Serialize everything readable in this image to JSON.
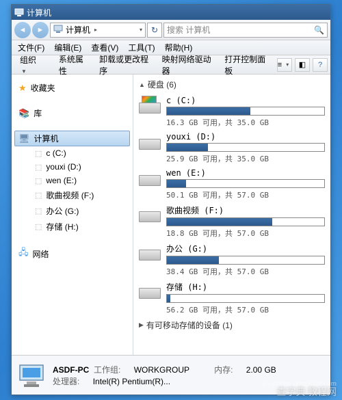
{
  "window": {
    "title": "计算机"
  },
  "addressbar": {
    "breadcrumb": "计算机",
    "search_placeholder": "搜索 计算机"
  },
  "menubar": {
    "file": "文件(F)",
    "edit": "编辑(E)",
    "view": "查看(V)",
    "tools": "工具(T)",
    "help": "帮助(H)"
  },
  "toolbar": {
    "organize": "组织",
    "sysprops": "系统属性",
    "uninstall": "卸载或更改程序",
    "mapdrive": "映射网络驱动器",
    "controlpanel": "打开控制面板"
  },
  "sidebar": {
    "favorites": "收藏夹",
    "libraries": "库",
    "computer": "计算机",
    "network": "网络",
    "drives": [
      {
        "label": "c (C:)"
      },
      {
        "label": "youxi (D:)"
      },
      {
        "label": "wen (E:)"
      },
      {
        "label": "歌曲视频 (F:)"
      },
      {
        "label": "办公 (G:)"
      },
      {
        "label": "存储 (H:)"
      }
    ]
  },
  "main": {
    "hdd_header": "硬盘 (6)",
    "removable_header": "有可移动存储的设备 (1)",
    "drives": [
      {
        "name": "c (C:)",
        "free": "16.3 GB",
        "total": "35.0 GB",
        "fill": 53,
        "sys": true
      },
      {
        "name": "youxi (D:)",
        "free": "25.9 GB",
        "total": "35.0 GB",
        "fill": 26,
        "sys": false
      },
      {
        "name": "wen (E:)",
        "free": "50.1 GB",
        "total": "57.0 GB",
        "fill": 12,
        "sys": false
      },
      {
        "name": "歌曲视频 (F:)",
        "free": "18.8 GB",
        "total": "57.0 GB",
        "fill": 67,
        "sys": false
      },
      {
        "name": "办公 (G:)",
        "free": "38.4 GB",
        "total": "57.0 GB",
        "fill": 33,
        "sys": false
      },
      {
        "name": "存储 (H:)",
        "free": "56.2 GB",
        "total": "57.0 GB",
        "fill": 2,
        "sys": false
      }
    ],
    "free_label": "可用，共"
  },
  "statusbar": {
    "pcname": "ASDF-PC",
    "workgroup_label": "工作组:",
    "workgroup": "WORKGROUP",
    "mem_label": "内存:",
    "mem": "2.00 GB",
    "cpu_label": "处理器:",
    "cpu": "Intel(R) Pentium(R)..."
  },
  "watermark": {
    "line1": "查字典 教程网",
    "line2": "jiaocheng.chazidian.com"
  }
}
